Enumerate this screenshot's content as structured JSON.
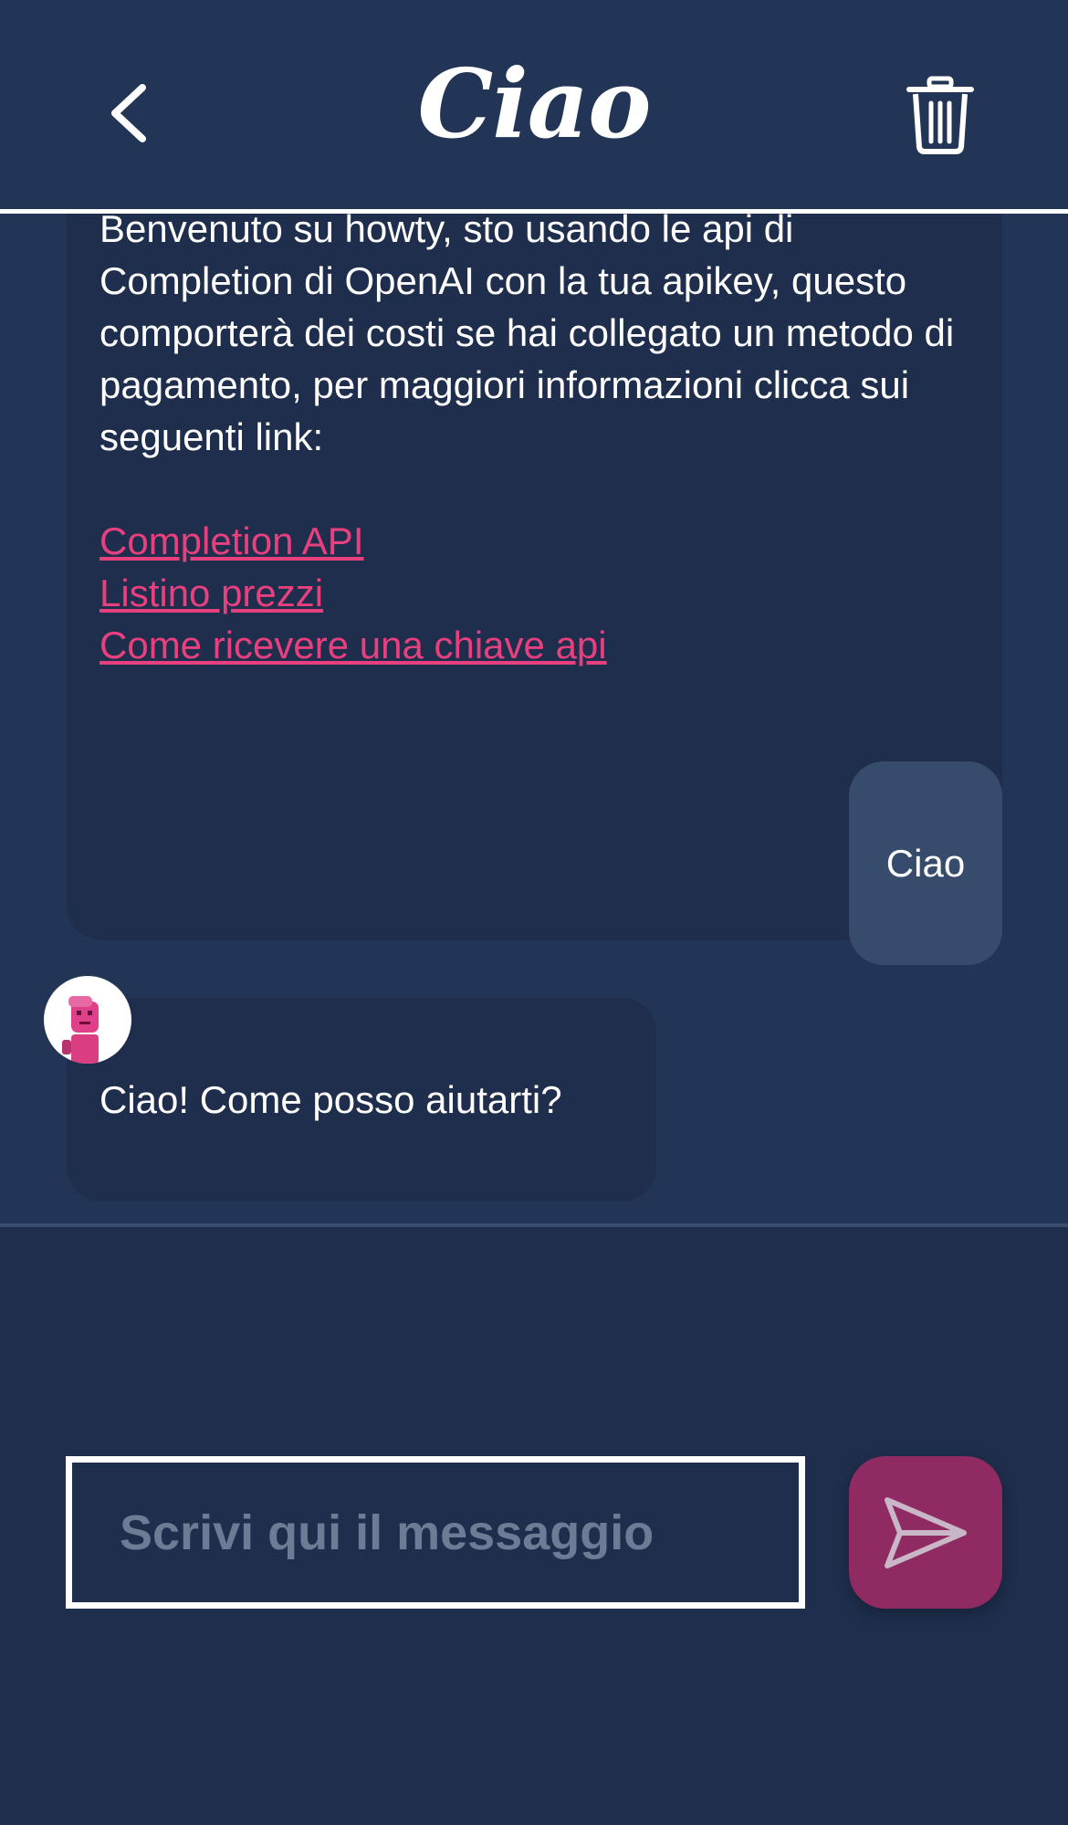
{
  "header": {
    "title": "Ciao",
    "back_icon": "chevron-left-icon",
    "delete_icon": "trash-icon"
  },
  "messages": {
    "intro": {
      "text": "Benvenuto su howty, sto usando le api di Completion di OpenAI con la tua apikey, questo comporterà dei costi se hai collegato un metodo di pagamento, per maggiori informazioni clicca sui seguenti link:",
      "links": [
        {
          "label": "Completion API"
        },
        {
          "label": "Listino prezzi"
        },
        {
          "label": "Come ricevere una chiave api"
        }
      ]
    },
    "user": {
      "text": "Ciao"
    },
    "reply": {
      "text": "Ciao! Come posso aiutarti?"
    }
  },
  "composer": {
    "placeholder": "Scrivi qui il messaggio",
    "value": "",
    "send_icon": "send-icon"
  },
  "colors": {
    "background": "#1e2e4c",
    "chat_area": "#223556",
    "user_bubble": "#374c6c",
    "link": "#e8407e",
    "send_button": "#8f2a63",
    "placeholder": "#6d7b94"
  }
}
